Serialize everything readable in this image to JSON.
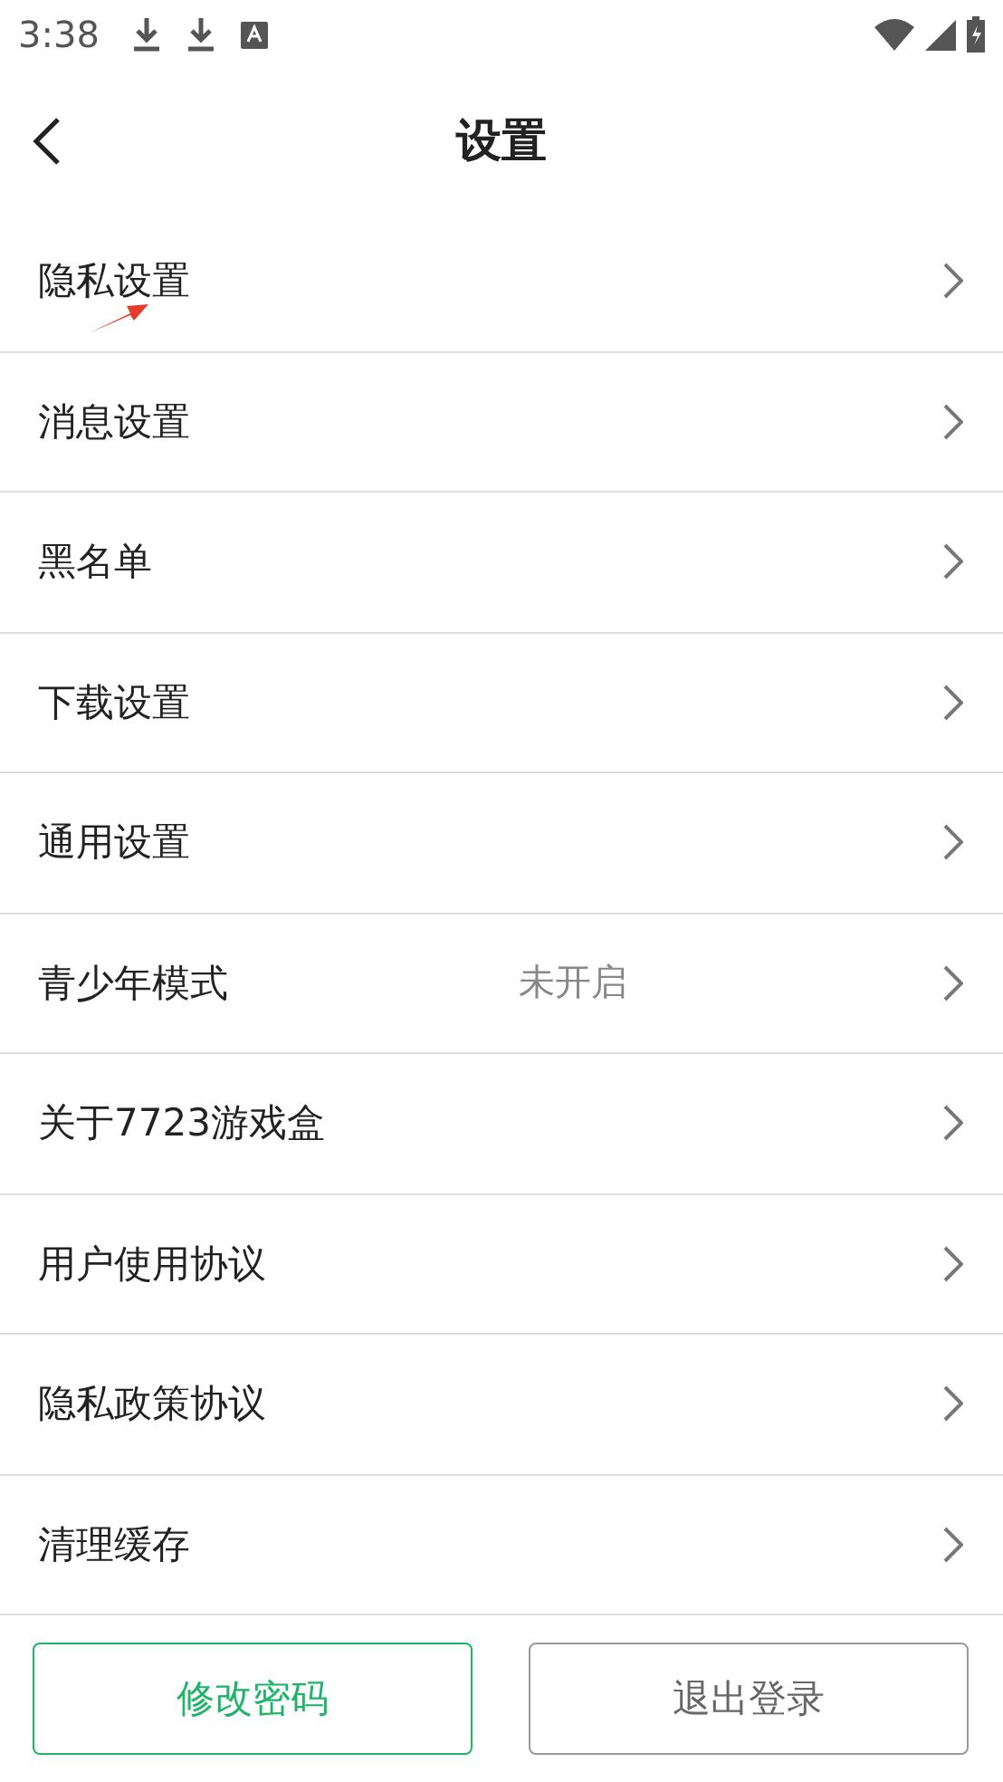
{
  "status_bar": {
    "time": "3:38"
  },
  "header": {
    "title": "设置"
  },
  "items": [
    {
      "label": "隐私设置",
      "annotated": true
    },
    {
      "label": "消息设置"
    },
    {
      "label": "黑名单"
    },
    {
      "label": "下载设置"
    },
    {
      "label": "通用设置"
    },
    {
      "label": "青少年模式",
      "value": "未开启"
    },
    {
      "label": "关于7723游戏盒"
    },
    {
      "label": "用户使用协议"
    },
    {
      "label": "隐私政策协议"
    },
    {
      "label": "清理缓存"
    }
  ],
  "buttons": [
    {
      "label": "修改密码",
      "kind": "primary"
    },
    {
      "label": "退出登录",
      "kind": "secondary"
    }
  ]
}
